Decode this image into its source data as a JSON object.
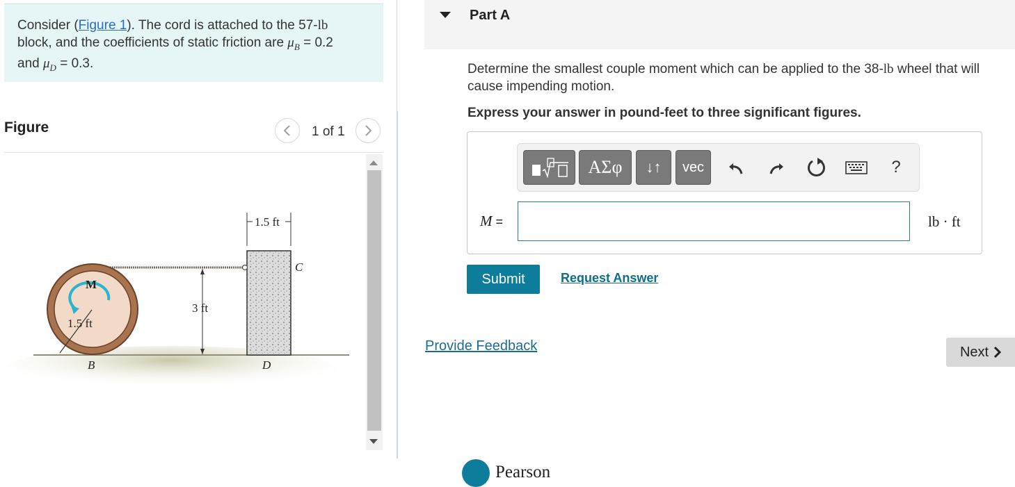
{
  "problem": {
    "text_before_link": "Consider (",
    "link_text": "Figure 1",
    "text_after_link": "). The cord is attached to the 57-",
    "weight_unit": "lb",
    "text_line_2": " block, and the coefficients of static friction are ",
    "mu_symbol": "μ",
    "mu_b_sub": "B",
    "mu_b_value": " = 0.2",
    "text_and": "and ",
    "mu_d_sub": "D",
    "mu_d_value": " = 0.3."
  },
  "figure_panel": {
    "title": "Figure",
    "prev_icon": "chevron-left-icon",
    "next_icon": "chevron-right-icon",
    "pager": "1 of 1",
    "labels": {
      "top_dim": "1.5 ft",
      "height_dim": "3 ft",
      "radius_dim": "1.5 ft",
      "moment": "M",
      "point_b": "B",
      "point_c": "C",
      "point_d": "D"
    }
  },
  "part": {
    "title": "Part A",
    "question_before": "Determine the smallest couple moment which can be applied to the 38-",
    "question_unit": "lb",
    "question_after": " wheel that will cause impending motion.",
    "instruction": "Express your answer in pound-feet to three significant figures."
  },
  "toolbar": {
    "templates_icon": "templates-icon",
    "greek_label": "ΑΣφ",
    "arrows_label": "↓↑",
    "vec_label": "vec",
    "undo_icon": "undo-icon",
    "redo_icon": "redo-icon",
    "reset_icon": "reset-icon",
    "keyboard_icon": "keyboard-icon",
    "help_label": "?"
  },
  "answer": {
    "variable": "M",
    "equals": " =",
    "value": "",
    "units": "lb · ft"
  },
  "actions": {
    "submit": "Submit",
    "request_answer": "Request Answer",
    "provide_feedback": "Provide Feedback",
    "next": "Next"
  },
  "footer": {
    "brand": "Pearson"
  },
  "colors": {
    "accent": "#0e7c9b",
    "problem_bg": "#e6f5f6",
    "link": "#2a6ebb",
    "wheel_rim": "#a8744f",
    "block": "#d9d9d9",
    "moment_arrow": "#2bb3cf"
  }
}
